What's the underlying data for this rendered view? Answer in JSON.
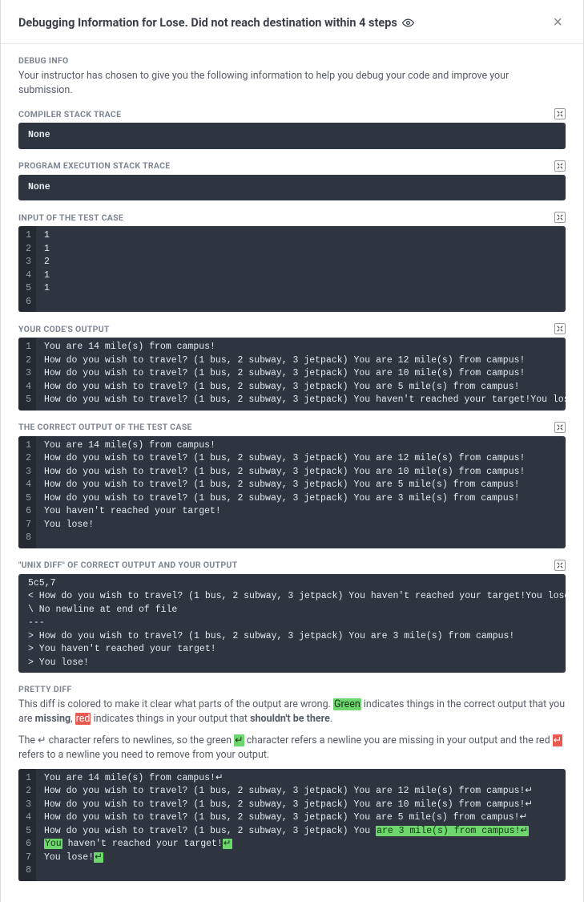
{
  "header": {
    "title": "Debugging Information for Lose. Did not reach destination within 4 steps"
  },
  "debug_info": {
    "label": "DEBUG INFO",
    "desc": "Your instructor has chosen to give you the following information to help you debug your code and improve your submission."
  },
  "compiler": {
    "label": "COMPILER STACK TRACE",
    "value": "None"
  },
  "program": {
    "label": "PROGRAM EXECUTION STACK TRACE",
    "value": "None"
  },
  "input": {
    "label": "INPUT OF THE TEST CASE",
    "lines": [
      "1",
      "1",
      "2",
      "1",
      "1",
      ""
    ]
  },
  "your_output": {
    "label": "YOUR CODE'S OUTPUT",
    "lines": [
      "You are 14 mile(s) from campus!",
      "How do you wish to travel? (1 bus, 2 subway, 3 jetpack) You are 12 mile(s) from campus!",
      "How do you wish to travel? (1 bus, 2 subway, 3 jetpack) You are 10 mile(s) from campus!",
      "How do you wish to travel? (1 bus, 2 subway, 3 jetpack) You are 5 mile(s) from campus!",
      "How do you wish to travel? (1 bus, 2 subway, 3 jetpack) You haven't reached your target!You lose!"
    ]
  },
  "correct_output": {
    "label": "THE CORRECT OUTPUT OF THE TEST CASE",
    "lines": [
      "You are 14 mile(s) from campus!",
      "How do you wish to travel? (1 bus, 2 subway, 3 jetpack) You are 12 mile(s) from campus!",
      "How do you wish to travel? (1 bus, 2 subway, 3 jetpack) You are 10 mile(s) from campus!",
      "How do you wish to travel? (1 bus, 2 subway, 3 jetpack) You are 5 mile(s) from campus!",
      "How do you wish to travel? (1 bus, 2 subway, 3 jetpack) You are 3 mile(s) from campus!",
      "You haven't reached your target!",
      "You lose!",
      ""
    ]
  },
  "unix_diff": {
    "label": "\"UNIX DIFF\" OF CORRECT OUTPUT AND YOUR OUTPUT",
    "lines": [
      "5c5,7",
      "< How do you wish to travel? (1 bus, 2 subway, 3 jetpack) You haven't reached your target!You lose!",
      "\\ No newline at end of file",
      "---",
      "> How do you wish to travel? (1 bus, 2 subway, 3 jetpack) You are 3 mile(s) from campus!",
      "> You haven't reached your target!",
      "> You lose!"
    ]
  },
  "pretty_diff": {
    "label": "PRETTY DIFF",
    "desc1_a": "This diff is colored to make it clear what parts of the output are wrong. ",
    "desc1_green": "Green",
    "desc1_b": " indicates things in the correct output that you are ",
    "desc1_missing": "missing",
    "desc1_c": ", ",
    "desc1_red": "red",
    "desc1_d": " indicates things in your output that ",
    "desc1_shouldnt": "shouldn't be there",
    "desc1_e": ".",
    "desc2_a": "The ",
    "desc2_nl": "↵",
    "desc2_b": " character refers to newlines, so the green ",
    "desc2_gnl": "↵",
    "desc2_c": " character refers a newline you are missing in your output and the red ",
    "desc2_rnl": "↵",
    "desc2_d": " refers to a newline you need to remove from your output.",
    "rows": [
      {
        "num": "1",
        "segs": [
          {
            "t": "You are 14 mile(s) from campus!",
            "c": ""
          },
          {
            "t": "↵",
            "c": ""
          }
        ]
      },
      {
        "num": "2",
        "segs": [
          {
            "t": "How do you wish to travel? (1 bus, 2 subway, 3 jetpack) You are 12 mile(s) from campus!",
            "c": ""
          },
          {
            "t": "↵",
            "c": ""
          }
        ]
      },
      {
        "num": "3",
        "segs": [
          {
            "t": "How do you wish to travel? (1 bus, 2 subway, 3 jetpack) You are 10 mile(s) from campus!",
            "c": ""
          },
          {
            "t": "↵",
            "c": ""
          }
        ]
      },
      {
        "num": "4",
        "segs": [
          {
            "t": "How do you wish to travel? (1 bus, 2 subway, 3 jetpack) You are 5 mile(s) from campus!",
            "c": ""
          },
          {
            "t": "↵",
            "c": ""
          }
        ]
      },
      {
        "num": "5",
        "segs": [
          {
            "t": "How do you wish to travel? (1 bus, 2 subway, 3 jetpack) You ",
            "c": ""
          },
          {
            "t": "are 3 mile(s) from campus!↵",
            "c": "g"
          }
        ]
      },
      {
        "num": "6",
        "segs": [
          {
            "t": "You",
            "c": "g"
          },
          {
            "t": " haven't reached your target!",
            "c": ""
          },
          {
            "t": "↵",
            "c": "g"
          }
        ]
      },
      {
        "num": "7",
        "segs": [
          {
            "t": "You lose!",
            "c": ""
          },
          {
            "t": "↵",
            "c": "g"
          }
        ]
      },
      {
        "num": "8",
        "segs": [
          {
            "t": "",
            "c": ""
          }
        ]
      }
    ]
  }
}
